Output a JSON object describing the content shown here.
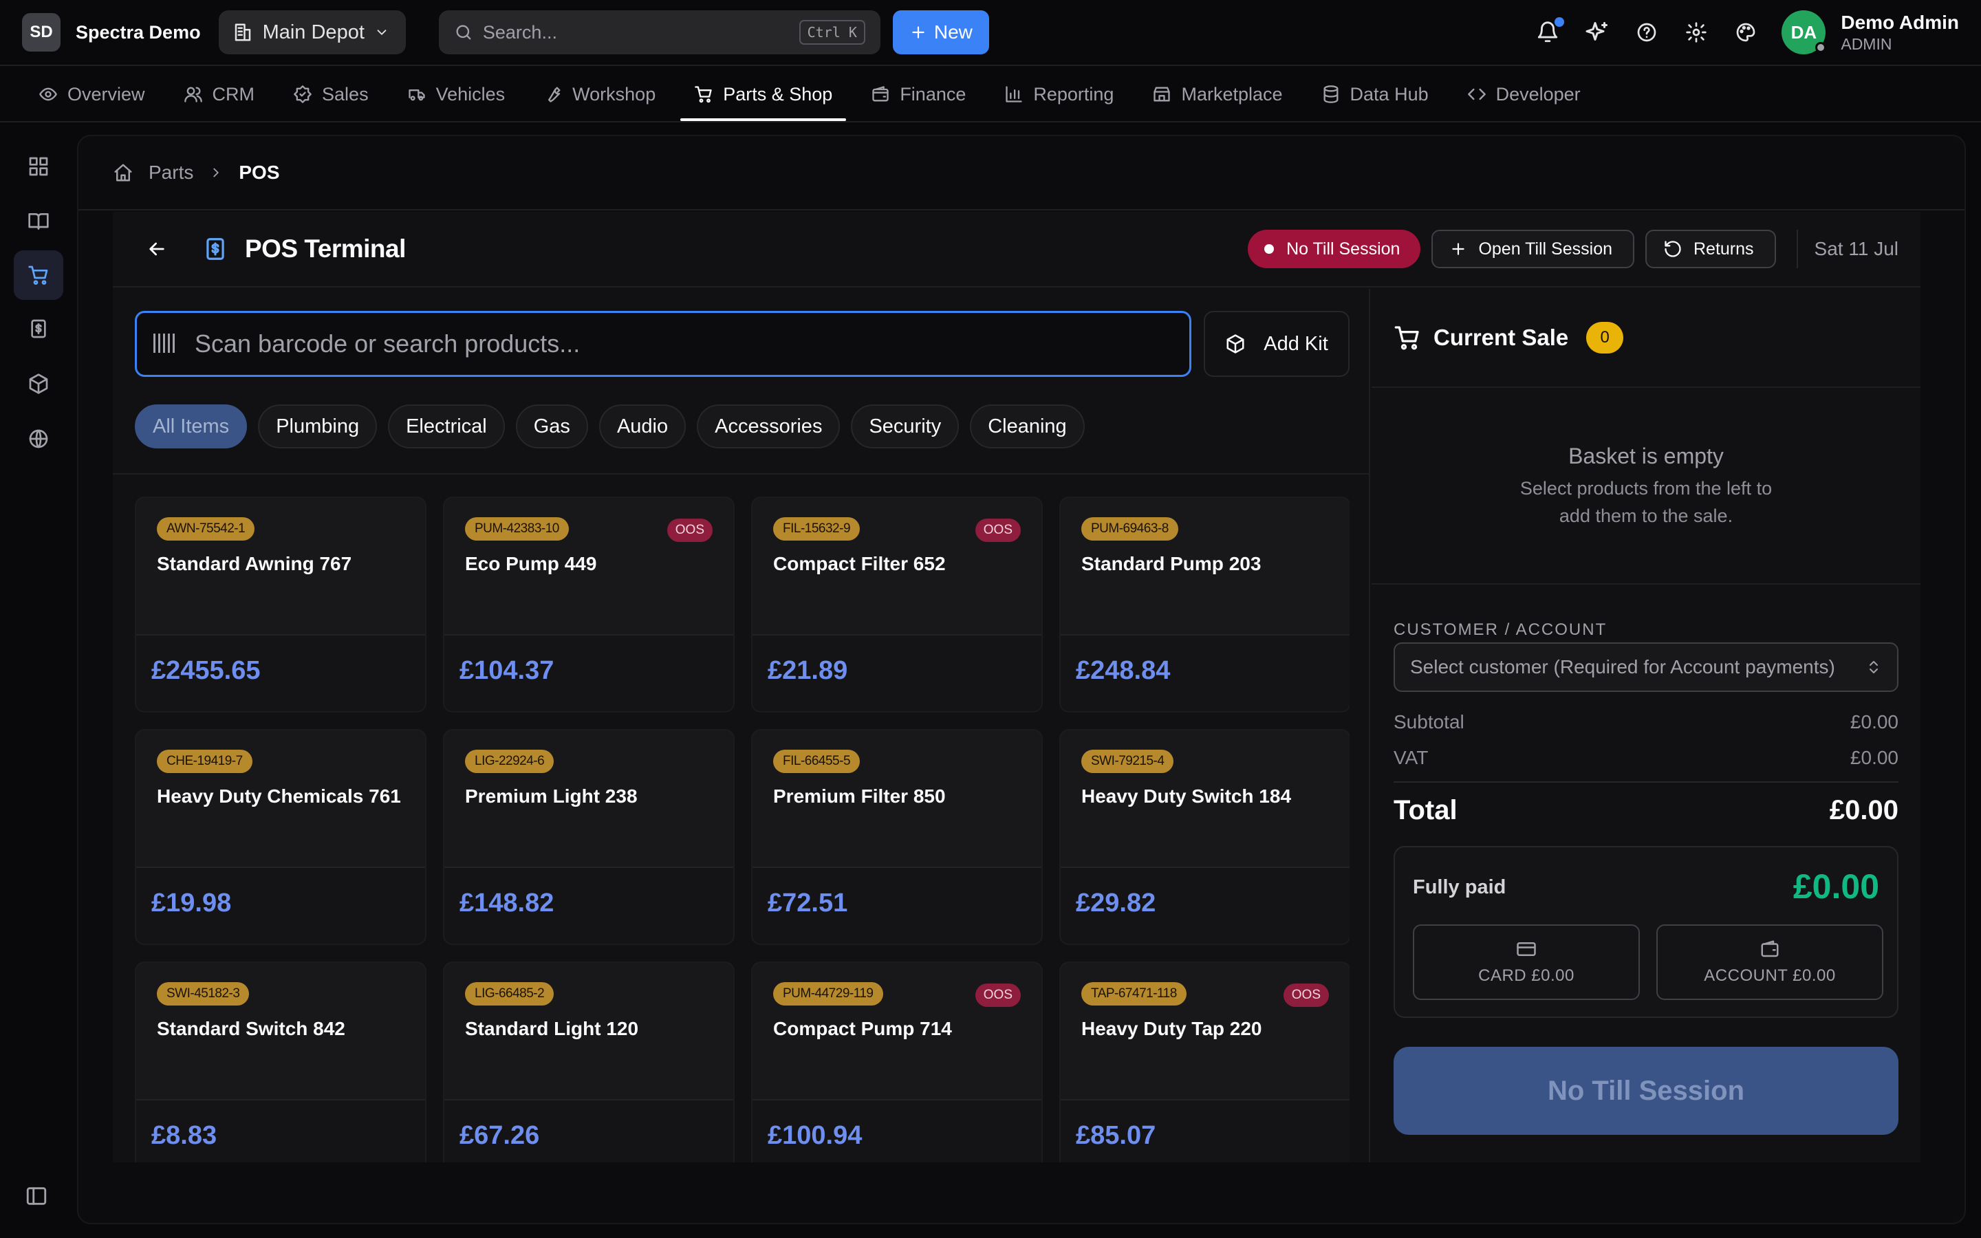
{
  "app": {
    "logo_initials": "SD",
    "brand": "Spectra Demo",
    "depot": "Main Depot",
    "search_placeholder": "Search...",
    "search_shortcut": "Ctrl K",
    "new_label": "New",
    "user_initials": "DA",
    "user_name": "Demo Admin",
    "user_role": "ADMIN"
  },
  "nav": [
    {
      "label": "Overview",
      "icon": "eye-icon"
    },
    {
      "label": "CRM",
      "icon": "users-icon"
    },
    {
      "label": "Sales",
      "icon": "badge-icon"
    },
    {
      "label": "Vehicles",
      "icon": "car-icon"
    },
    {
      "label": "Workshop",
      "icon": "wrench-icon"
    },
    {
      "label": "Parts & Shop",
      "icon": "cart-icon",
      "active": true
    },
    {
      "label": "Finance",
      "icon": "wallet-icon"
    },
    {
      "label": "Reporting",
      "icon": "bar-chart-icon"
    },
    {
      "label": "Marketplace",
      "icon": "store-icon"
    },
    {
      "label": "Data Hub",
      "icon": "database-icon"
    },
    {
      "label": "Developer",
      "icon": "code-icon"
    }
  ],
  "breadcrumb": {
    "parent": "Parts",
    "current": "POS"
  },
  "pos": {
    "title": "POS Terminal",
    "till_status": "No Till Session",
    "open_till_label": "Open Till Session",
    "returns_label": "Returns",
    "date": "Sat 11 Jul",
    "scan_placeholder": "Scan barcode or search products...",
    "add_kit_label": "Add Kit",
    "categories": [
      "All Items",
      "Plumbing",
      "Electrical",
      "Gas",
      "Audio",
      "Accessories",
      "Security",
      "Cleaning"
    ],
    "products": [
      {
        "sku": "AWN-75542-1",
        "name": "Standard Awning 767",
        "price": "£2455.65",
        "oos": ""
      },
      {
        "sku": "PUM-42383-10",
        "name": "Eco Pump 449",
        "price": "£104.37",
        "oos": "OOS"
      },
      {
        "sku": "FIL-15632-9",
        "name": "Compact Filter 652",
        "price": "£21.89",
        "oos": "OOS"
      },
      {
        "sku": "PUM-69463-8",
        "name": "Standard Pump 203",
        "price": "£248.84",
        "oos": ""
      },
      {
        "sku": "CHE-19419-7",
        "name": "Heavy Duty Chemicals 761",
        "price": "£19.98",
        "oos": ""
      },
      {
        "sku": "LIG-22924-6",
        "name": "Premium Light 238",
        "price": "£148.82",
        "oos": ""
      },
      {
        "sku": "FIL-66455-5",
        "name": "Premium Filter 850",
        "price": "£72.51",
        "oos": ""
      },
      {
        "sku": "SWI-79215-4",
        "name": "Heavy Duty Switch 184",
        "price": "£29.82",
        "oos": ""
      },
      {
        "sku": "SWI-45182-3",
        "name": "Standard Switch 842",
        "price": "£8.83",
        "oos": ""
      },
      {
        "sku": "LIG-66485-2",
        "name": "Standard Light 120",
        "price": "£67.26",
        "oos": ""
      },
      {
        "sku": "PUM-44729-119",
        "name": "Compact Pump 714",
        "price": "£100.94",
        "oos": "OOS"
      },
      {
        "sku": "TAP-67471-118",
        "name": "Heavy Duty Tap 220",
        "price": "£85.07",
        "oos": "OOS"
      }
    ]
  },
  "sale": {
    "title": "Current Sale",
    "count": "0",
    "empty_title": "Basket is empty",
    "empty_sub": "Select products from the left to add them to the sale.",
    "customer_label": "CUSTOMER / ACCOUNT",
    "customer_placeholder": "Select customer (Required for Account payments)",
    "subtotal_label": "Subtotal",
    "subtotal": "£0.00",
    "vat_label": "VAT",
    "vat": "£0.00",
    "total_label": "Total",
    "total": "£0.00",
    "paid_label": "Fully paid",
    "paid_amount": "£0.00",
    "card_label": "CARD £0.00",
    "account_label": "ACCOUNT £0.00",
    "action_label": "No Till Session"
  },
  "colors": {
    "accent": "#3b82f6",
    "success": "#10b981",
    "danger": "#9f1239",
    "sku": "#b68a2c",
    "count": "#eab308"
  }
}
